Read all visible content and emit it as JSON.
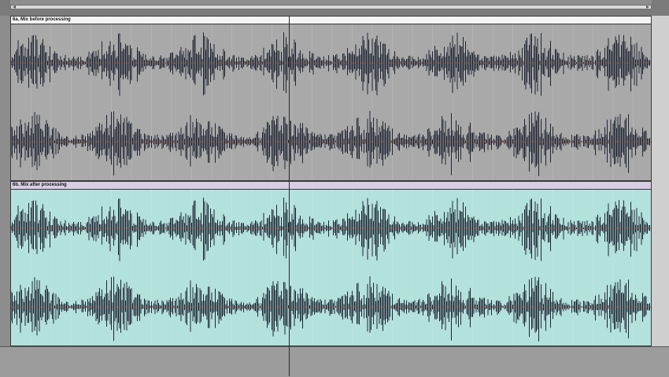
{
  "clips": [
    {
      "id": "before",
      "title": "6a. Mix before processing",
      "color": "#a9a9a9"
    },
    {
      "id": "after",
      "title": "6b. Mix after processing",
      "color": "#b3e1dc"
    }
  ],
  "scrollbar": {
    "left_arrow": "◂",
    "right_arrow": "▸"
  },
  "colors": {
    "waveform": "#1f2533",
    "center_line": "#d04a2a"
  }
}
